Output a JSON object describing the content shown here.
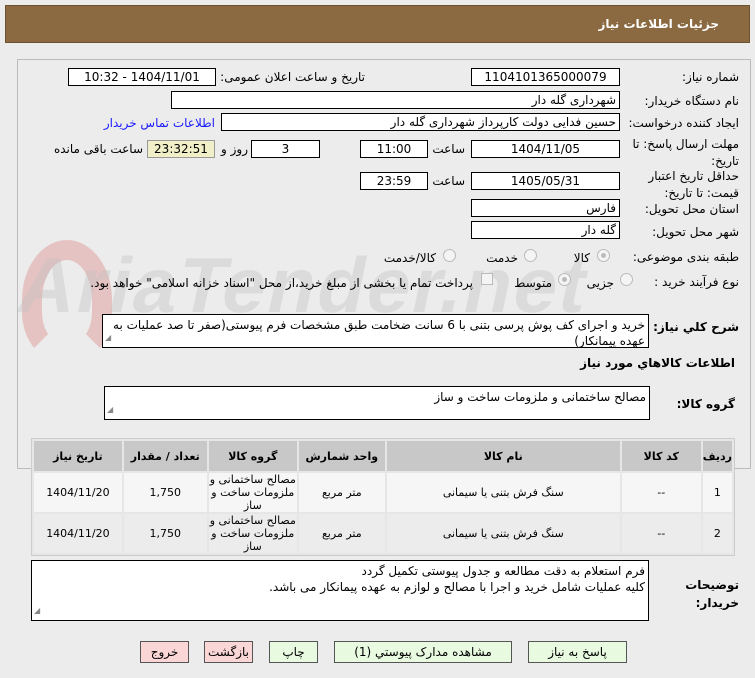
{
  "header": {
    "title": "جزئیات اطلاعات نیاز"
  },
  "form": {
    "need_number_label": "شماره نیاز:",
    "need_number": "1104101365000079",
    "announce_label": "تاریخ و ساعت اعلان عمومی:",
    "announce_value": "1404/11/01 - 10:32",
    "buyer_label": "نام دستگاه خریدار:",
    "buyer": "شهرداری گله دار",
    "creator_label": "ایجاد کننده درخواست:",
    "creator": "حسین فدایی دولت کارپرداز شهرداری گله دار",
    "contact_link": "اطلاعات تماس خریدار",
    "deadline_label": "مهلت ارسال پاسخ: تا تاریخ:",
    "deadline_date": "1404/11/05",
    "time_label": "ساعت",
    "deadline_time": "11:00",
    "days": "3",
    "days_label": "روز و",
    "remaining": "23:32:51",
    "remaining_label": "ساعت باقی مانده",
    "validity_label": "حداقل تاریخ اعتبار قیمت: تا تاریخ:",
    "validity_date": "1405/05/31",
    "validity_time": "23:59",
    "province_label": "استان محل تحویل:",
    "province": "فارس",
    "city_label": "شهر محل تحویل:",
    "city": "گله دار",
    "category_label": "طبقه بندی موضوعی:",
    "category_options": [
      "کالا",
      "خدمت",
      "کالا/خدمت"
    ],
    "category_selected": "کالا",
    "process_label": "نوع فرآیند خرید :",
    "process_options": [
      "جزیی",
      "متوسط"
    ],
    "process_selected": "متوسط",
    "payment_note": "پرداخت تمام یا بخشی از مبلغ خرید،از محل \"اسناد خزانه اسلامی\" خواهد بود.",
    "description_label": "شرح کلي نياز:",
    "description": "خرید و اجرای کف پوش پرسی بتنی با 6 سانت ضخامت طبق مشخصات فرم پیوستی(صفر تا صد عملیات به عهده پیمانکار)",
    "goods_info_title": "اطلاعات کالاهاي مورد نياز",
    "group_label": "گروه کالا:",
    "group": "مصالح ساختمانی و ملزومات ساخت و ساز"
  },
  "table": {
    "headers": [
      "ردیف",
      "کد کالا",
      "نام کالا",
      "واحد شمارش",
      "گروه کالا",
      "تعداد / مقدار",
      "تاریخ نیاز"
    ],
    "rows": [
      [
        "1",
        "--",
        "سنگ فرش بتنی یا سیمانی",
        "متر مربع",
        "مصالح ساختمانی و ملزومات ساخت و ساز",
        "1,750",
        "1404/11/20"
      ],
      [
        "2",
        "--",
        "سنگ فرش بتنی یا سیمانی",
        "متر مربع",
        "مصالح ساختمانی و ملزومات ساخت و ساز",
        "1,750",
        "1404/11/20"
      ]
    ]
  },
  "notes": {
    "label": "توضیحات خریدار:",
    "line1": "فرم استعلام به دقت مطالعه و جدول پیوستی تکمیل گردد",
    "line2": "کلیه عملیات شامل خرید و اجرا با مصالح و لوازم به عهده پیمانکار می باشد."
  },
  "buttons": {
    "reply": "پاسخ به نیاز",
    "attachments": "مشاهده مدارک پیوستي (1)",
    "print": "چاپ",
    "back": "بازگشت",
    "exit": "خروج"
  },
  "watermark": "AriaTender.net",
  "colors": {
    "header": "#8b6a42",
    "green_button": "#e8fbe0",
    "pink_button": "#fbd6d6",
    "link": "#1a1aff"
  }
}
